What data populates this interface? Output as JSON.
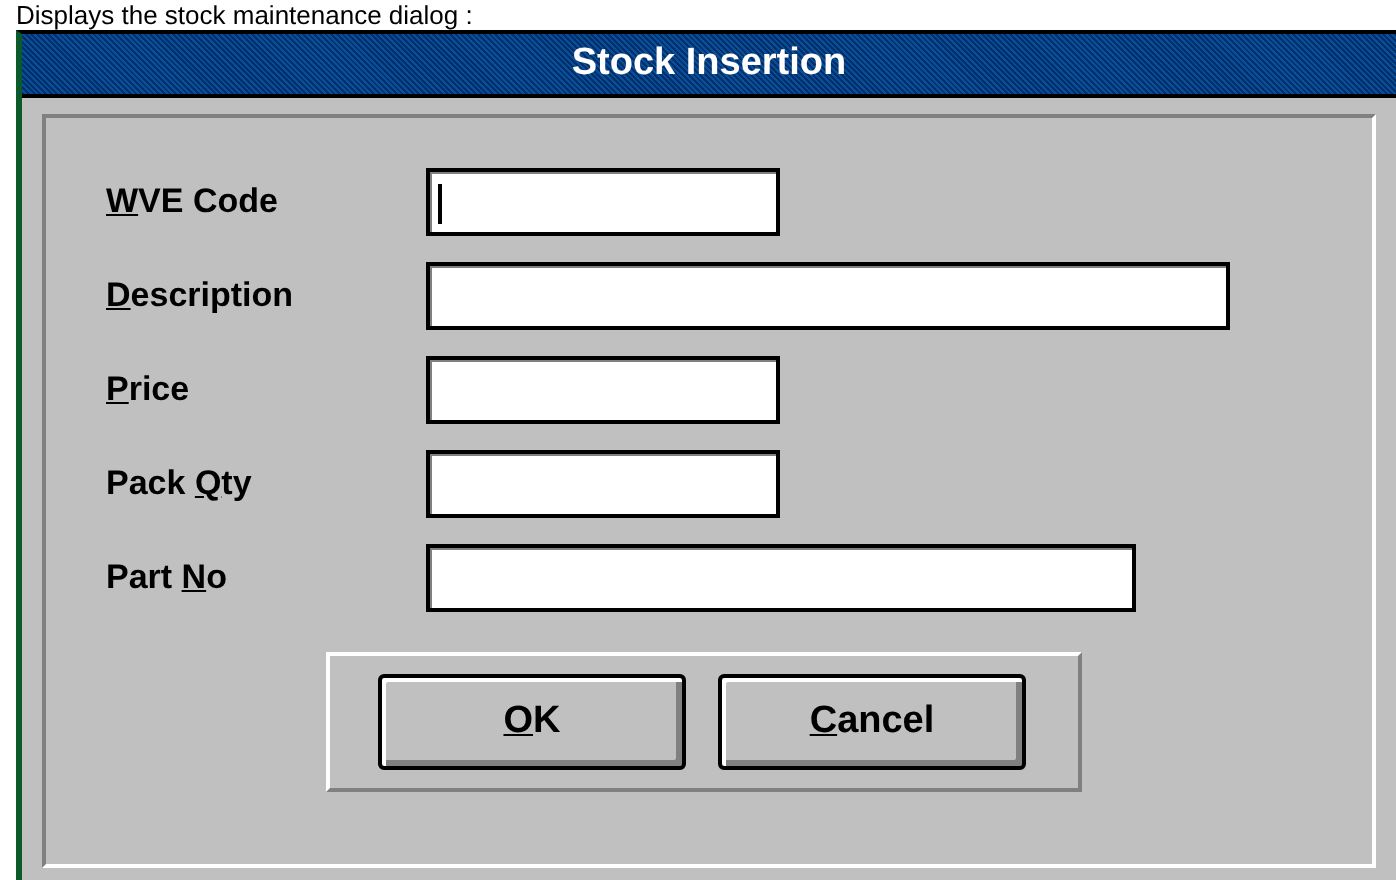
{
  "caption": "Displays the stock maintenance dialog :",
  "window": {
    "title": "Stock Insertion"
  },
  "fields": [
    {
      "label": {
        "key": "W",
        "post": "VE Code"
      },
      "kind": "short",
      "focused": true
    },
    {
      "label": {
        "key": "D",
        "post": "escription"
      },
      "kind": "long",
      "focused": false
    },
    {
      "label": {
        "key": "P",
        "post": "rice"
      },
      "kind": "short",
      "focused": false
    },
    {
      "label": {
        "pre": "Pack ",
        "key": "Q",
        "post": "ty"
      },
      "kind": "short",
      "focused": false
    },
    {
      "label": {
        "pre": "Part ",
        "key": "N",
        "post": "o"
      },
      "kind": "medium",
      "focused": false
    }
  ],
  "buttons": [
    {
      "label": {
        "key": "O",
        "post": "K"
      }
    },
    {
      "label": {
        "key": "C",
        "post": "ancel"
      }
    }
  ]
}
